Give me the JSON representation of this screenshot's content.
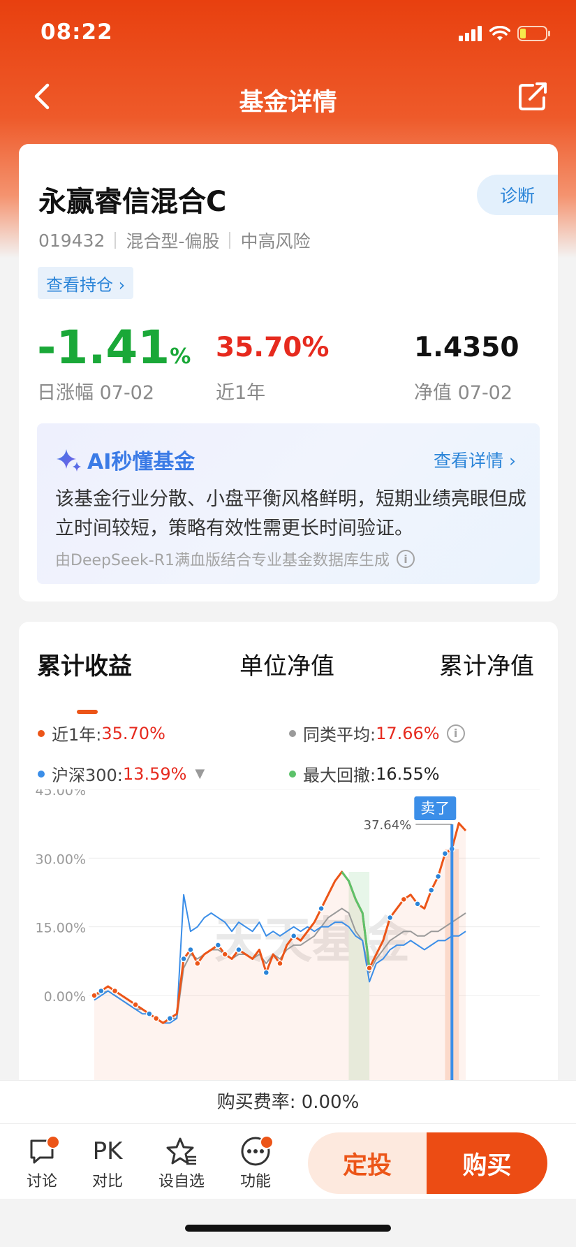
{
  "status": {
    "time": "08:22"
  },
  "nav": {
    "title": "基金详情"
  },
  "fund": {
    "name": "永赢睿信混合C",
    "code": "019432",
    "type": "混合型-偏股",
    "risk": "中高风险",
    "diagnose_label": "诊断",
    "holdings_label": "查看持仓 ›",
    "daily_change": "-1.41",
    "daily_change_unit": "%",
    "daily_label": "日涨幅 07-02",
    "year_return": "35.70%",
    "year_label": "近1年",
    "nav_value": "1.4350",
    "nav_label": "净值 07-02"
  },
  "ai": {
    "title": "AI秒懂基金",
    "detail_link": "查看详情 ›",
    "text": "该基金行业分散、小盘平衡风格鲜明，短期业绩亮眼但成立时间较短，策略有效性需更长时间验证。",
    "source": "由DeepSeek-R1满血版结合专业基金数据库生成"
  },
  "chart_section": {
    "tabs": [
      "累计收益",
      "单位净值",
      "累计净值"
    ],
    "active_tab": 0,
    "legend": [
      {
        "label": "近1年:",
        "value": "35.70%",
        "color": "#ec5518"
      },
      {
        "label": "同类平均:",
        "value": "17.66%",
        "color": "#9a9a9a"
      },
      {
        "label": "沪深300:",
        "value": "13.59%",
        "color": "#3b8ee8"
      },
      {
        "label": "最大回撤:",
        "value": "16.55%",
        "color": "#5cc26a"
      }
    ],
    "sell_tag": "卖了",
    "last_value_label": "37.64%",
    "watermark": "天天基金"
  },
  "chart_data": {
    "type": "line",
    "ytick_labels": [
      "45.00%",
      "30.00%",
      "15.00%",
      "0.00%"
    ],
    "ylim": [
      -6,
      45
    ],
    "grid": true,
    "series": [
      {
        "name": "近1年",
        "color": "#ec5518",
        "values": [
          0,
          1,
          2,
          1,
          0,
          -1,
          -2,
          -3,
          -4,
          -5,
          -6,
          -5,
          -4,
          8,
          10,
          7,
          9,
          10,
          11,
          9,
          8,
          10,
          9,
          8,
          10,
          5,
          9,
          7,
          11,
          13,
          12,
          14,
          16,
          19,
          22,
          25,
          27,
          25,
          21,
          18,
          6,
          9,
          12,
          17,
          19,
          21,
          22,
          20,
          19,
          23,
          26,
          31,
          32,
          37.64,
          36
        ]
      },
      {
        "name": "同类平均",
        "color": "#9a9a9a",
        "values": [
          0,
          0.5,
          1,
          0,
          -1,
          -2,
          -3,
          -3,
          -4,
          -5,
          -6,
          -5,
          -5,
          6,
          9,
          8,
          9,
          10,
          10,
          9,
          8,
          9,
          9,
          8,
          9,
          7,
          9,
          8,
          10,
          11,
          11,
          12,
          13,
          15,
          17,
          18,
          19,
          18,
          14,
          12,
          5,
          8,
          10,
          12,
          13,
          14,
          14,
          13,
          13,
          14,
          14,
          15,
          16,
          17,
          18
        ]
      },
      {
        "name": "沪深300",
        "color": "#3b8ee8",
        "values": [
          -1,
          0,
          1,
          0,
          -1,
          -2,
          -3,
          -4,
          -4,
          -5,
          -6,
          -6,
          -5,
          22,
          14,
          15,
          17,
          18,
          17,
          16,
          14,
          16,
          15,
          14,
          16,
          13,
          14,
          13,
          14,
          15,
          14,
          15,
          14,
          15,
          15,
          16,
          16,
          15,
          13,
          12,
          3,
          7,
          8,
          10,
          11,
          11,
          12,
          11,
          10,
          11,
          12,
          12,
          13,
          13,
          14
        ]
      }
    ]
  },
  "footer": {
    "fee_text": "购买费率: 0.00%",
    "nav_items": [
      "讨论",
      "对比",
      "设自选",
      "功能"
    ],
    "pk_label": "PK",
    "dingtou_label": "定投",
    "buy_label": "购买"
  }
}
